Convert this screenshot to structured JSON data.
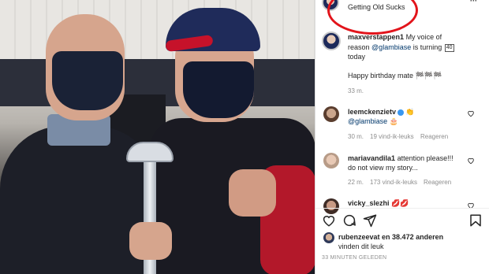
{
  "post": {
    "top_caption": "Getting Old Sucks",
    "author": "maxverstappen1",
    "caption_part1": "My voice of",
    "caption_part2": "reason",
    "caption_mention": "@glambiase",
    "caption_part3": "is turning",
    "caption_number": "40",
    "caption_part4": "today",
    "caption_line2": "Happy birthday mate",
    "caption_emojis": "🏁🏁🏁",
    "caption_time": "33 m."
  },
  "comments": [
    {
      "user": "leemckenzietv",
      "verified": true,
      "emoji_after_name": "👏",
      "mention": "@glambiase",
      "emoji_after_mention": "🎂",
      "time": "30 m.",
      "likes": "19 vind-ik-leuks",
      "reply": "Reageren"
    },
    {
      "user": "mariavandila1",
      "text_line1": "attention please!!!",
      "text_line2": "do not view my story...",
      "time": "22 m.",
      "likes": "173 vind-ik-leuks",
      "reply": "Reageren"
    },
    {
      "user": "vicky_slezhi",
      "emoji": "💋💋"
    }
  ],
  "likes_row": {
    "liker": "rubenzeevat",
    "text": "en 38.472 anderen",
    "text_line2": "vinden dit leuk",
    "timestamp": "33 MINUTEN GELEDEN"
  },
  "colors": {
    "highlight": "#e2141b",
    "link": "#00376b",
    "meta": "#8e8e8e",
    "verified": "#3897f0"
  }
}
